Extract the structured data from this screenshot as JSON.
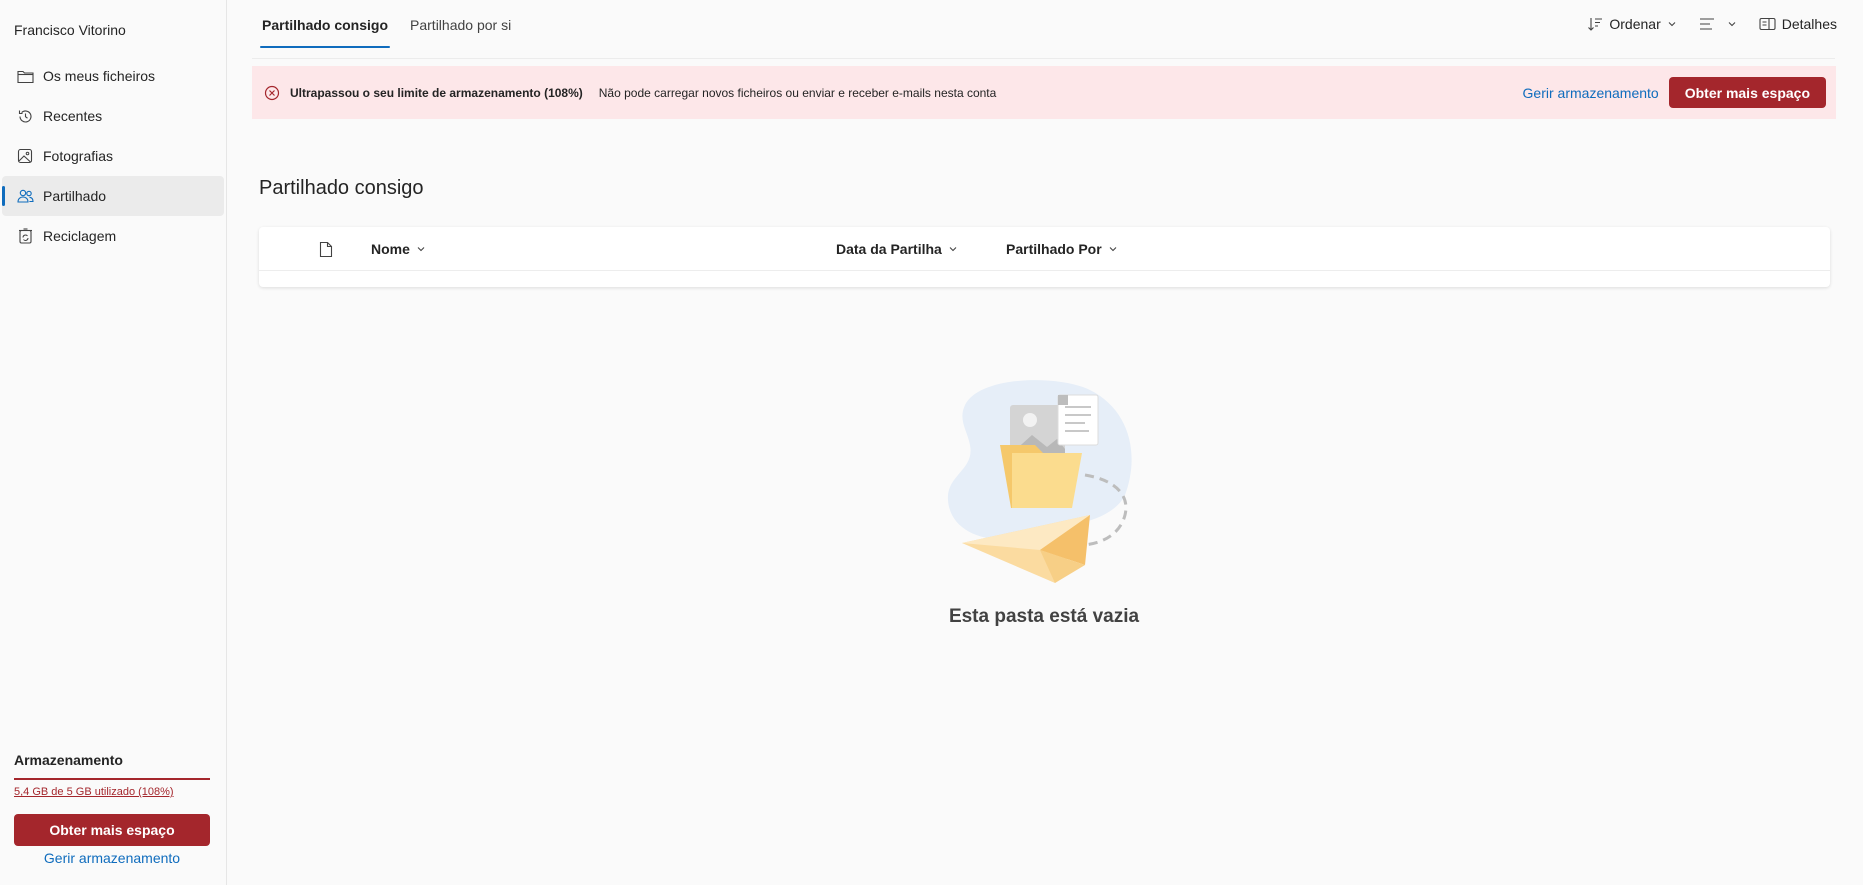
{
  "sidebar": {
    "user_name": "Francisco Vitorino",
    "items": [
      {
        "label": "Os meus ficheiros",
        "icon": "folder-icon",
        "active": false
      },
      {
        "label": "Recentes",
        "icon": "history-icon",
        "active": false
      },
      {
        "label": "Fotografias",
        "icon": "photo-icon",
        "active": false
      },
      {
        "label": "Partilhado",
        "icon": "people-icon",
        "active": true
      },
      {
        "label": "Reciclagem",
        "icon": "recycle-bin-icon",
        "active": false
      }
    ],
    "storage": {
      "title": "Armazenamento",
      "usage": "5,4 GB de 5 GB utilizado (108%)",
      "percent_used": 108,
      "get_more_label": "Obter mais espaço",
      "manage_label": "Gerir armazenamento"
    }
  },
  "tabs": [
    {
      "label": "Partilhado consigo",
      "active": true
    },
    {
      "label": "Partilhado por si",
      "active": false
    }
  ],
  "toolbar": {
    "sort_label": "Ordenar",
    "details_label": "Detalhes"
  },
  "alert": {
    "title": "Ultrapassou o seu limite de armazenamento (108%)",
    "message": "Não pode carregar novos ficheiros ou enviar e receber e-mails nesta conta",
    "manage_label": "Gerir armazenamento",
    "get_more_label": "Obter mais espaço"
  },
  "main": {
    "title": "Partilhado consigo",
    "columns": {
      "name": "Nome",
      "date": "Data da Partilha",
      "shared_by": "Partilhado Por"
    },
    "empty_text": "Esta pasta está vazia"
  },
  "colors": {
    "accent": "#0f6cbd",
    "danger": "#a4262c",
    "alert_bg": "#fde7e9"
  }
}
